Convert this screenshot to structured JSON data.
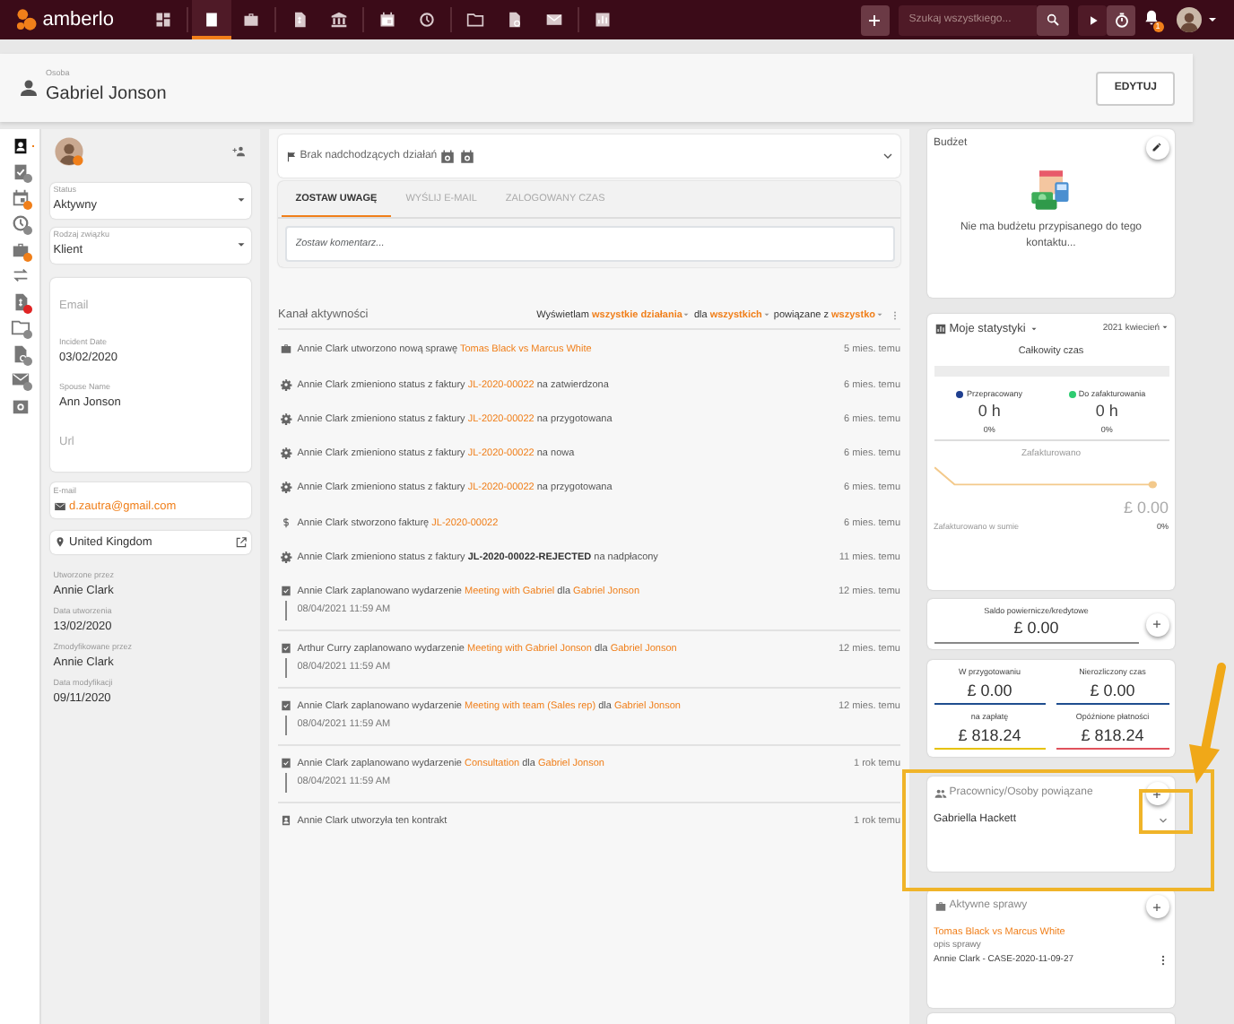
{
  "navbar": {
    "brand": "amberlo",
    "nav_items": [
      {
        "kind": "dashboard",
        "selected": false
      },
      {
        "kind": "contact",
        "selected": true
      },
      {
        "kind": "briefcase",
        "selected": false
      },
      {
        "kind": "invoice",
        "selected": false
      },
      {
        "kind": "bank",
        "selected": false
      },
      {
        "kind": "calendar",
        "selected": false
      },
      {
        "kind": "history",
        "selected": false
      },
      {
        "kind": "folder",
        "selected": false
      },
      {
        "kind": "docs",
        "selected": false
      },
      {
        "kind": "mail",
        "selected": false
      },
      {
        "kind": "chart",
        "selected": false
      }
    ],
    "search": {
      "placeholder": "Szukaj wszystkiego..."
    },
    "notification_count": "1"
  },
  "header": {
    "type_label": "Osoba",
    "name": "Gabriel Jonson",
    "edit_button": "EDYTUJ"
  },
  "side_strip": [
    {
      "kind": "contact",
      "selected": true
    },
    {
      "kind": "tasks",
      "selected": false,
      "color": "#8a8a8a"
    },
    {
      "kind": "calendar",
      "selected": false,
      "color": "#f07f1a"
    },
    {
      "kind": "history",
      "selected": false,
      "color": "#8a8a8a"
    },
    {
      "kind": "briefcase",
      "selected": false,
      "color": "#f07f1a"
    },
    {
      "kind": "transfer",
      "selected": false
    },
    {
      "kind": "invoice",
      "selected": false,
      "color": "#e02424"
    },
    {
      "kind": "folder",
      "selected": false,
      "color": "#8a8a8a"
    },
    {
      "kind": "docs",
      "selected": false,
      "color": "#8a8a8a"
    },
    {
      "kind": "mail",
      "selected": false,
      "color": "#8a8a8a"
    },
    {
      "kind": "settings",
      "selected": false
    }
  ],
  "contact_panel": {
    "selects": [
      {
        "label": "Status",
        "value": "Aktywny"
      },
      {
        "label": "Rodzaj związku",
        "value": "Klient"
      }
    ],
    "fields": [
      {
        "placeholder": "Email"
      },
      {
        "label": "Incident Date",
        "value": "03/02/2020"
      },
      {
        "label": "Spouse Name",
        "value": "Ann Jonson"
      },
      {
        "placeholder": "Url"
      }
    ],
    "email": {
      "label": "E-mail",
      "value": "d.zautra@gmail.com"
    },
    "address": "United Kingdom",
    "meta": [
      {
        "label": "Utworzone przez",
        "value": "Annie Clark"
      },
      {
        "label": "Data utworzenia",
        "value": "13/02/2020"
      },
      {
        "label": "Zmodyfikowane przez",
        "value": "Annie Clark"
      },
      {
        "label": "Data modyfikacji",
        "value": "09/11/2020"
      }
    ]
  },
  "upcoming": {
    "text": "Brak nadchodzących działań"
  },
  "compose": {
    "tabs": [
      {
        "label": "ZOSTAW UWAGĘ",
        "selected": true
      },
      {
        "label": "WYŚLIJ E-MAIL",
        "selected": false
      },
      {
        "label": "ZALOGOWANY CZAS",
        "selected": false
      }
    ],
    "placeholder": "Zostaw komentarz..."
  },
  "feed": {
    "title": "Kanał aktywności",
    "filter": [
      {
        "text": "Wyświetlam",
        "kind": "plain"
      },
      {
        "text": "wszystkie działania",
        "kind": "link"
      },
      {
        "text": "dla",
        "kind": "plain"
      },
      {
        "text": "wszystkich",
        "kind": "link"
      },
      {
        "text": "powiązane z",
        "kind": "plain"
      },
      {
        "text": "wszystko",
        "kind": "link"
      }
    ],
    "items": [
      {
        "kind": "briefcase",
        "parts": [
          {
            "text": "Annie Clark utworzono nową sprawę ",
            "kind": "plain"
          },
          {
            "text": "Tomas Black vs Marcus White",
            "kind": "link"
          }
        ],
        "time": "5 mies. temu"
      },
      {
        "kind": "gear",
        "parts": [
          {
            "text": "Annie Clark zmieniono status z faktury ",
            "kind": "plain"
          },
          {
            "text": "JL-2020-00022",
            "kind": "link"
          },
          {
            "text": " na zatwierdzona",
            "kind": "plain"
          }
        ],
        "time": "6 mies. temu"
      },
      {
        "kind": "gear",
        "parts": [
          {
            "text": "Annie Clark zmieniono status z faktury ",
            "kind": "plain"
          },
          {
            "text": "JL-2020-00022",
            "kind": "link"
          },
          {
            "text": " na przygotowana",
            "kind": "plain"
          }
        ],
        "time": "6 mies. temu"
      },
      {
        "kind": "gear",
        "parts": [
          {
            "text": "Annie Clark zmieniono status z faktury ",
            "kind": "plain"
          },
          {
            "text": "JL-2020-00022",
            "kind": "link"
          },
          {
            "text": " na nowa",
            "kind": "plain"
          }
        ],
        "time": "6 mies. temu"
      },
      {
        "kind": "gear",
        "parts": [
          {
            "text": "Annie Clark zmieniono status z faktury ",
            "kind": "plain"
          },
          {
            "text": "JL-2020-00022",
            "kind": "link"
          },
          {
            "text": " na przygotowana",
            "kind": "plain"
          }
        ],
        "time": "6 mies. temu"
      },
      {
        "kind": "dollar",
        "parts": [
          {
            "text": "Annie Clark stworzono fakturę ",
            "kind": "plain"
          },
          {
            "text": "JL-2020-00022",
            "kind": "link"
          }
        ],
        "time": "6 mies. temu"
      },
      {
        "kind": "gear",
        "parts": [
          {
            "text": "Annie Clark zmieniono status z faktury ",
            "kind": "plain"
          },
          {
            "text": "JL-2020-00022-REJECTED",
            "kind": "bold"
          },
          {
            "text": " na nadpłacony",
            "kind": "plain"
          }
        ],
        "time": "11 mies. temu"
      },
      {
        "kind": "event",
        "parts": [
          {
            "text": "Annie Clark zaplanowano wydarzenie ",
            "kind": "plain"
          },
          {
            "text": "Meeting with Gabriel",
            "kind": "link"
          },
          {
            "text": " dla ",
            "kind": "plain"
          },
          {
            "text": "Gabriel Jonson",
            "kind": "link"
          }
        ],
        "time": "12 mies. temu",
        "date": "08/04/2021 11:59 AM"
      },
      {
        "kind": "event",
        "parts": [
          {
            "text": "Arthur Curry zaplanowano wydarzenie ",
            "kind": "plain"
          },
          {
            "text": "Meeting with Gabriel Jonson",
            "kind": "link"
          },
          {
            "text": " dla ",
            "kind": "plain"
          },
          {
            "text": "Gabriel Jonson",
            "kind": "link"
          }
        ],
        "time": "12 mies. temu",
        "date": "08/04/2021 11:59 AM"
      },
      {
        "kind": "event",
        "parts": [
          {
            "text": "Annie Clark zaplanowano wydarzenie ",
            "kind": "plain"
          },
          {
            "text": "Meeting with team (Sales rep)",
            "kind": "link"
          },
          {
            "text": " dla ",
            "kind": "plain"
          },
          {
            "text": "Gabriel Jonson",
            "kind": "link"
          }
        ],
        "time": "12 mies. temu",
        "date": "08/04/2021 11:59 AM"
      },
      {
        "kind": "event",
        "parts": [
          {
            "text": "Annie Clark zaplanowano wydarzenie ",
            "kind": "plain"
          },
          {
            "text": "Consultation",
            "kind": "link"
          },
          {
            "text": " dla ",
            "kind": "plain"
          },
          {
            "text": "Gabriel Jonson",
            "kind": "link"
          }
        ],
        "time": "1 rok temu",
        "date": "08/04/2021 11:59 AM"
      },
      {
        "kind": "contact",
        "parts": [
          {
            "text": "Annie Clark utworzyła ten kontrakt",
            "kind": "plain"
          }
        ],
        "time": "1 rok temu"
      }
    ]
  },
  "budget": {
    "title": "Budżet",
    "text": "Nie ma budżetu przypisanego do tego kontaktu..."
  },
  "stats": {
    "title": "Moje statystyki",
    "period": "2021 kwiecień",
    "total_label": "Całkowity czas",
    "legend": [
      {
        "label": "Przepracowany",
        "color": "#1f3f8f",
        "value": "0 h",
        "percent": "0%"
      },
      {
        "label": "Do zafakturowania",
        "color": "#2ecc71",
        "value": "0 h",
        "percent": "0%"
      }
    ],
    "billed_label": "Zafakturowano",
    "billed_total_label": "Zafakturowano w sumie",
    "billed_total": "£ 0.00",
    "billed_percent": "0%"
  },
  "balance": {
    "label": "Saldo powiernicze/kredytowe",
    "value": "£ 0.00"
  },
  "summary": [
    {
      "label": "W przygotowaniu",
      "value": "£ 0.00",
      "color": "#1f4e8f"
    },
    {
      "label": "Nierozliczony czas",
      "value": "£ 0.00",
      "color": "#1f4e8f"
    },
    {
      "label": "na zapłatę",
      "value": "£ 818.24",
      "color": "#e6c200"
    },
    {
      "label": "Opóźnione płatności",
      "value": "£ 818.24",
      "color": "#e0525c"
    }
  ],
  "related": {
    "title": "Pracownicy/Osoby powiązane",
    "items": [
      "Gabriella Hackett"
    ]
  },
  "cases": {
    "title": "Aktywne sprawy",
    "items": [
      {
        "title": "Tomas Black vs Marcus White",
        "description": "opis sprawy",
        "meta": "Annie Clark - CASE-2020-11-09-27"
      }
    ]
  }
}
